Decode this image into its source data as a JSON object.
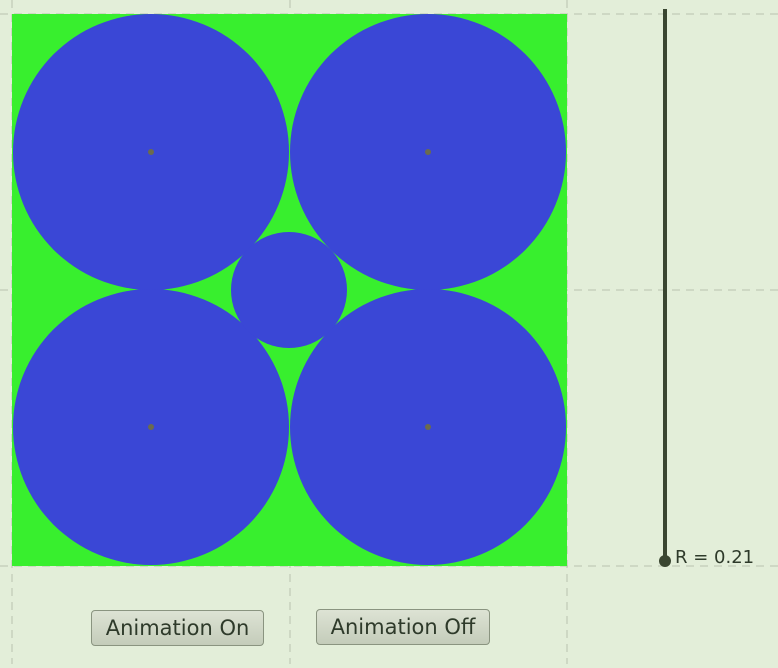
{
  "buttons": {
    "animation_on": "Animation On",
    "animation_off": "Animation Off"
  },
  "slider": {
    "label": "R = 0.21",
    "value": 0.21
  },
  "colors": {
    "background": "#e3eed9",
    "square_fill": "#38ef2e",
    "circle_fill": "#3a47d6",
    "slider_color": "#3a4631",
    "grid_line": "#b8c2ae",
    "center_dot": "#6b6b4e"
  },
  "scene": {
    "large_circles": 4,
    "small_circles": 1
  }
}
